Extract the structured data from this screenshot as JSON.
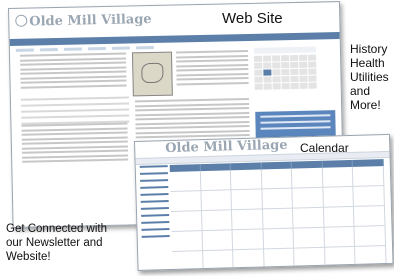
{
  "captions": {
    "web_site": "Web Site",
    "side_features": [
      "History",
      "Health",
      "Utilities",
      "and",
      "More!"
    ],
    "calendar": "Calendar",
    "newsletter": [
      "Get Connected with",
      "our Newsletter and",
      "Website!"
    ]
  },
  "website_preview": {
    "logo_text": "Olde Mill Village"
  },
  "calendar_preview": {
    "logo_text": "Olde Mill Village"
  },
  "colors": {
    "nav_blue": "#5b7fa8",
    "promo_blue": "#5b86bd",
    "logo_grey": "#9aa6b2"
  }
}
